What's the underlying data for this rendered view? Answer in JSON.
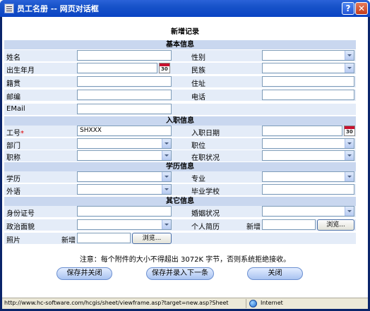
{
  "window": {
    "title": "员工名册 -- 网页对话框",
    "help_label": "?",
    "close_label": "✕"
  },
  "form": {
    "heading": "新增记录",
    "sections": {
      "basic": "基本信息",
      "employment": "入职信息",
      "education": "学历信息",
      "other": "其它信息"
    },
    "labels": {
      "name": "姓名",
      "gender": "性别",
      "birth": "出生年月",
      "ethnicity": "民族",
      "origin": "籍贯",
      "address": "住址",
      "postcode": "邮编",
      "phone": "电话",
      "email": "EMail",
      "employee_id": "工号",
      "hire_date": "入职日期",
      "department": "部门",
      "position": "职位",
      "title": "职称",
      "status": "在职状况",
      "education": "学历",
      "major": "专业",
      "language": "外语",
      "school": "毕业学校",
      "id_card": "身份证号",
      "marital": "婚姻状况",
      "political": "政治面貌",
      "resume": "个人简历",
      "photo": "照片"
    },
    "required_mark": "*",
    "values": {
      "employee_id": "SHXXX"
    },
    "new_label": "新增",
    "browse_label": "浏览..."
  },
  "note": "注意：每个附件的大小不得超出 3072K 字节，否则系统拒绝接收。",
  "buttons": {
    "save_close": "保存并关闭",
    "save_next": "保存并录入下一条",
    "close": "关闭"
  },
  "statusbar": {
    "url": "http://www.hc-software.com/hcgis/sheet/viewframe.asp?target=new.asp?Sheet",
    "zone": "Internet"
  }
}
